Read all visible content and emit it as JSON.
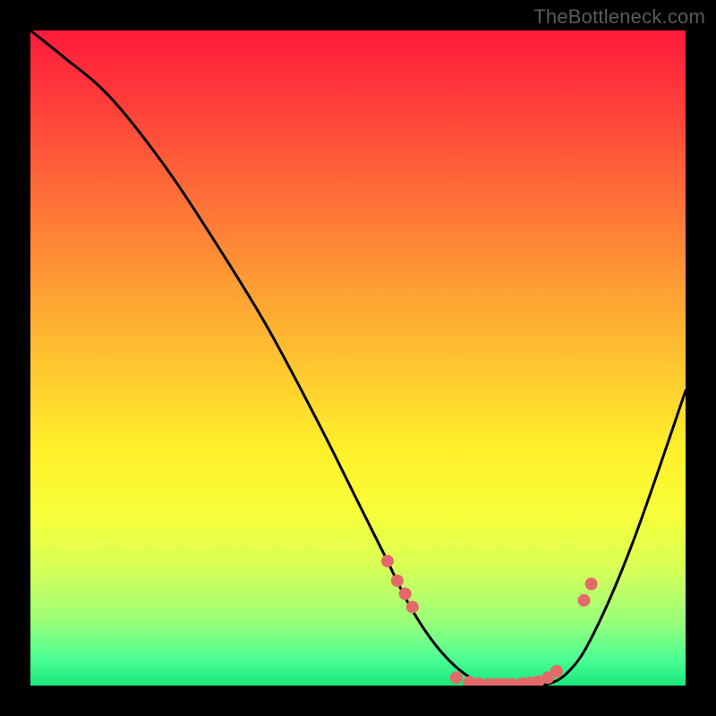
{
  "watermark": "TheBottleneck.com",
  "chart_data": {
    "type": "line",
    "title": "",
    "xlabel": "",
    "ylabel": "",
    "xlim": [
      0,
      100
    ],
    "ylim": [
      0,
      100
    ],
    "series": [
      {
        "name": "bottleneck-curve",
        "x": [
          0,
          5,
          12,
          20,
          28,
          36,
          44,
          50,
          54,
          58,
          62,
          66,
          70,
          74,
          78,
          82,
          86,
          92,
          100
        ],
        "y": [
          100,
          96,
          90,
          80,
          68,
          55,
          40,
          28,
          20,
          12,
          6,
          2,
          0,
          0,
          0,
          2,
          8,
          22,
          45
        ]
      }
    ],
    "markers": {
      "name": "highlight-points",
      "x": [
        54.5,
        56,
        57.2,
        58.3,
        65,
        67,
        68.5,
        70,
        71.2,
        72.3,
        73.5,
        75,
        76.2,
        77.5,
        79,
        80.3,
        84.5,
        85.6
      ],
      "y": [
        19,
        16,
        14,
        12,
        1.2,
        0.5,
        0.3,
        0.2,
        0.2,
        0.2,
        0.2,
        0.3,
        0.4,
        0.6,
        1.2,
        2.2,
        13,
        15.5
      ]
    }
  }
}
